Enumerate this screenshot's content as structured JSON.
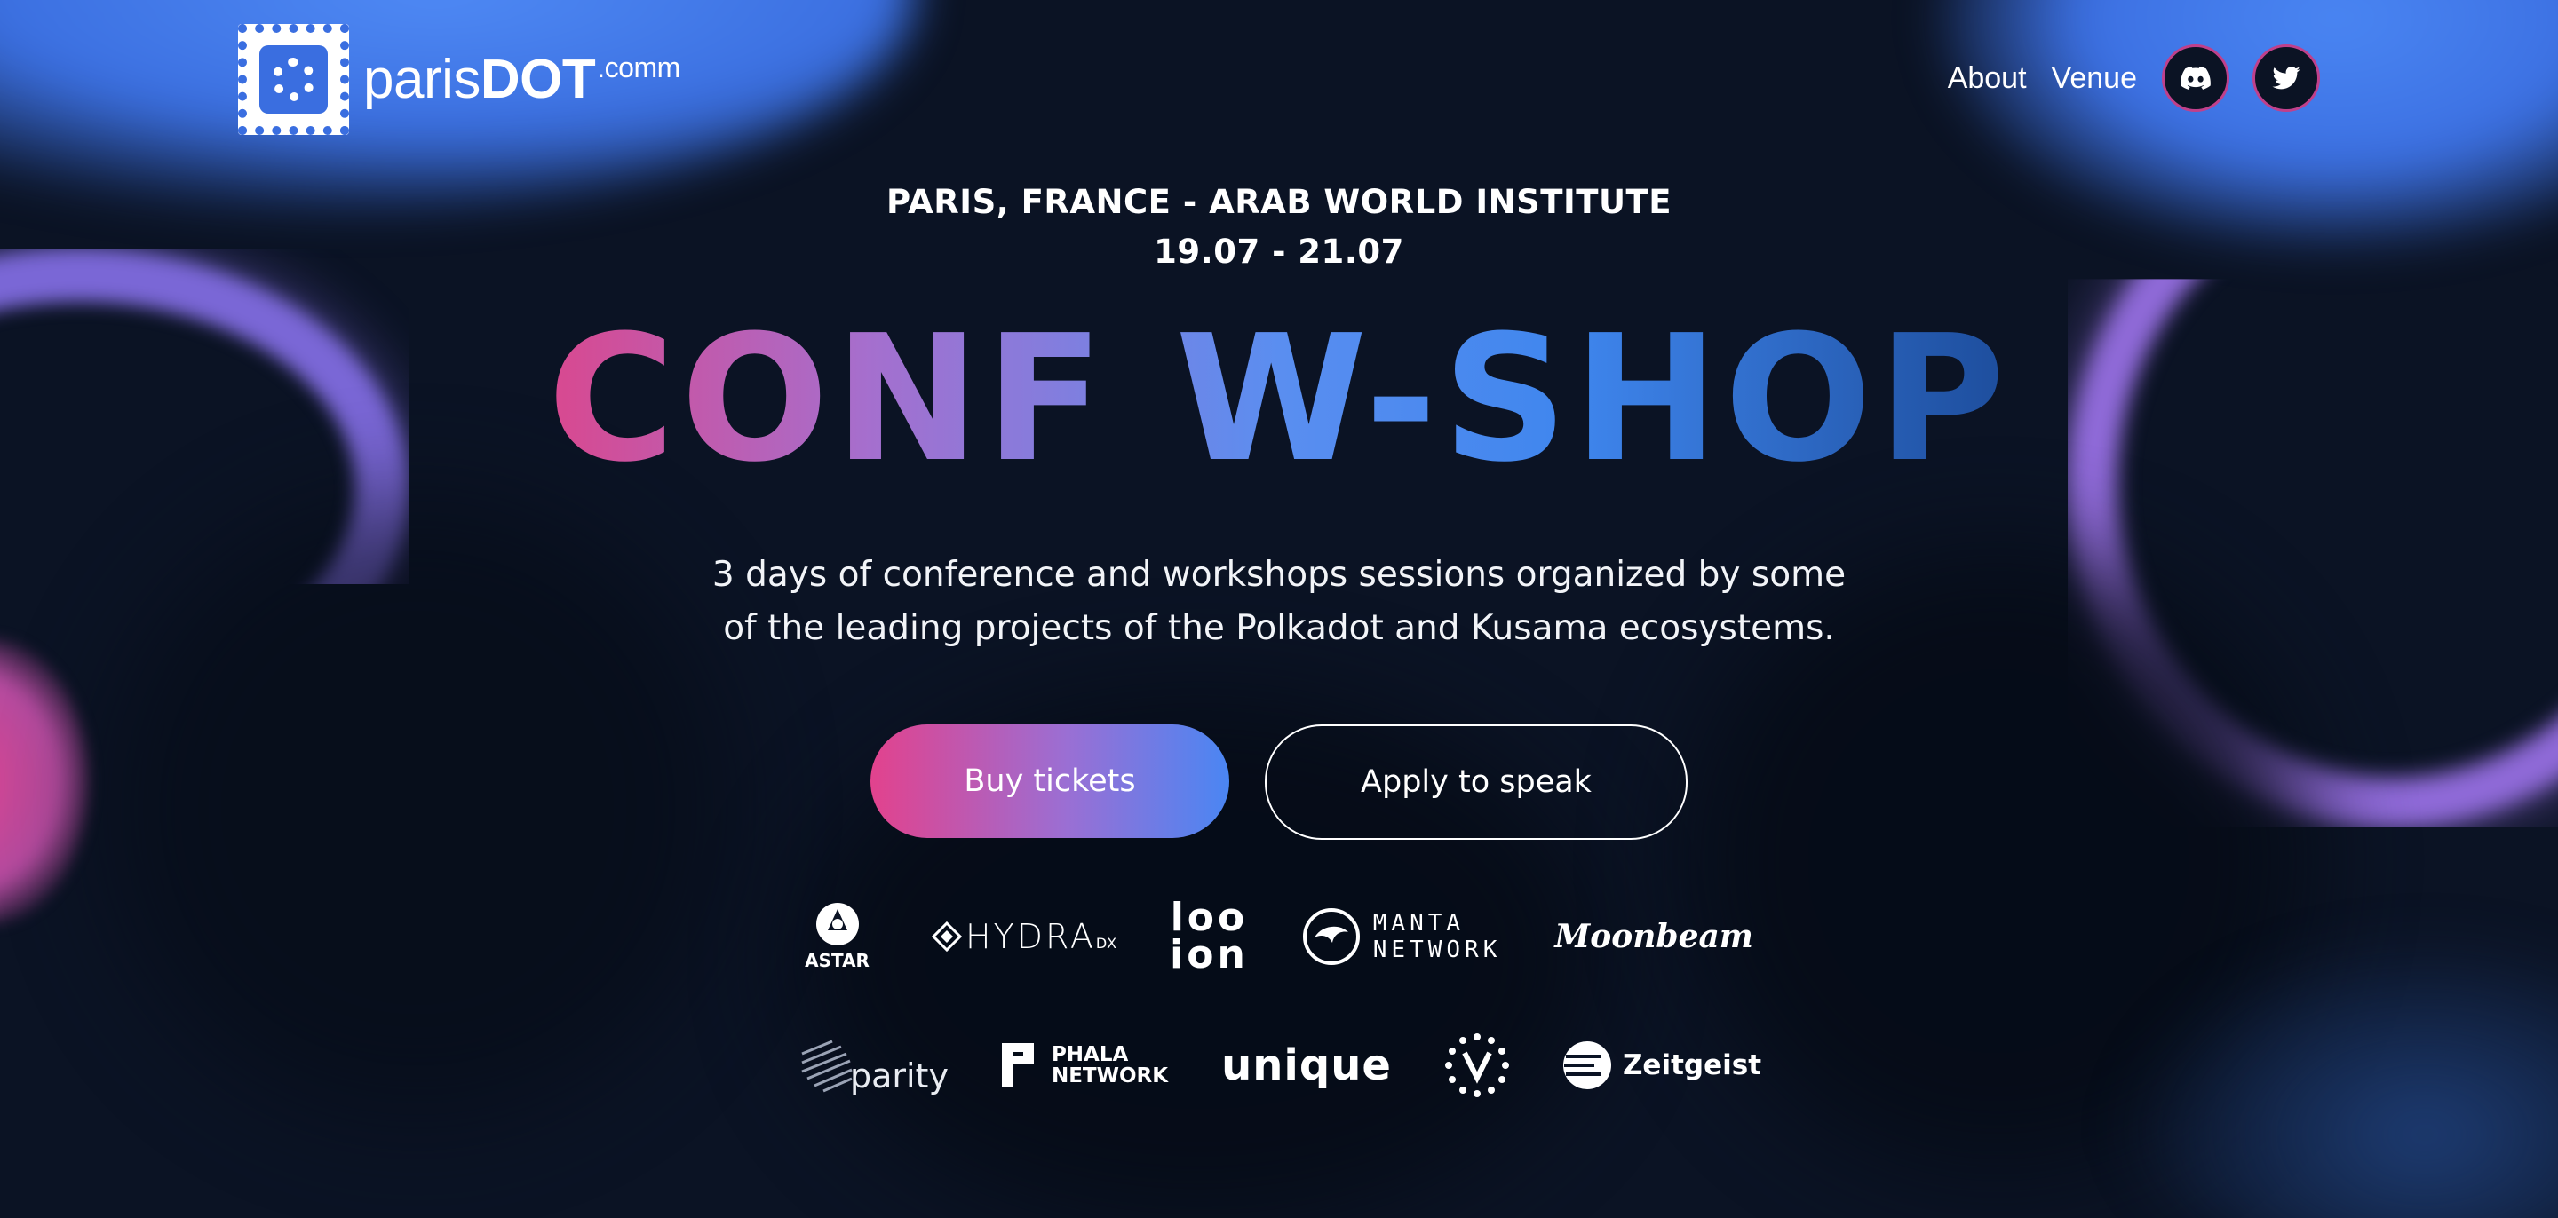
{
  "header": {
    "logo_text_regular": "paris",
    "logo_text_bold": "DOT",
    "logo_text_suffix": ".comm",
    "nav": [
      {
        "label": "About"
      },
      {
        "label": "Venue"
      }
    ],
    "social": [
      {
        "icon": "discord-icon"
      },
      {
        "icon": "twitter-icon"
      }
    ]
  },
  "hero": {
    "location": "PARIS, FRANCE - ARAB WORLD INSTITUTE",
    "dates": "19.07 - 21.07",
    "title": "CONF W-SHOP",
    "description_line1": "3 days of conference and workshops sessions organized by some",
    "description_line2": "of the leading projects of the Polkadot and Kusama ecosystems.",
    "buy_label": "Buy tickets",
    "apply_label": "Apply to speak"
  },
  "partners": {
    "row1": [
      {
        "name": "ASTAR"
      },
      {
        "name": "HYDRA",
        "suffix": "DX"
      },
      {
        "name_top": "loo",
        "name_bottom": "ion"
      },
      {
        "name_top": "MANTA",
        "name_bottom": "NETWORK"
      },
      {
        "name": "Moonbeam"
      }
    ],
    "row2": [
      {
        "name": "parity"
      },
      {
        "name_top": "PHALA",
        "name_bottom": "NETWORK"
      },
      {
        "name": "unique"
      },
      {
        "name": "zeitgeist",
        "label": "Zeitgeist"
      }
    ]
  },
  "colors": {
    "background": "#0b1324",
    "accent_pink": "#e2428d",
    "accent_blue": "#4a86f3",
    "accent_purple": "#9a6fd4"
  }
}
